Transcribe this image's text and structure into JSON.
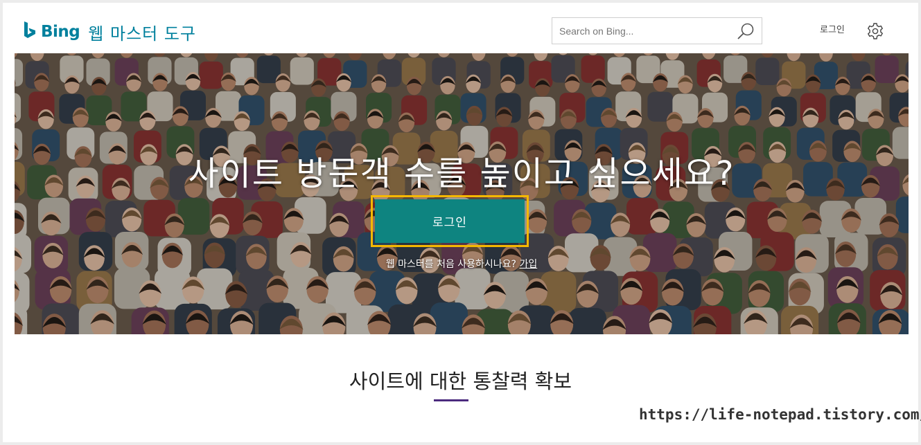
{
  "header": {
    "brand": "Bing",
    "product": "웹 마스터 도구",
    "search_placeholder": "Search on Bing...",
    "login_label": "로그인",
    "icons": {
      "logo": "bing-logo-icon",
      "search": "search-icon",
      "settings": "gear-icon"
    }
  },
  "hero": {
    "title": "사이트 방문객 수를 높이고 싶으세요?",
    "login_button": "로그인",
    "signup_prompt": "웹 마스터를 처음 사용하시나요?",
    "signup_link": "가입"
  },
  "section": {
    "title": "사이트에 대한 통찰력 확보"
  },
  "watermark": "https://life-notepad.tistory.com/",
  "colors": {
    "brand_teal": "#00809d",
    "button_teal": "#0e8480",
    "highlight_border": "#f5b800",
    "underline_purple": "#4b2a7e"
  }
}
